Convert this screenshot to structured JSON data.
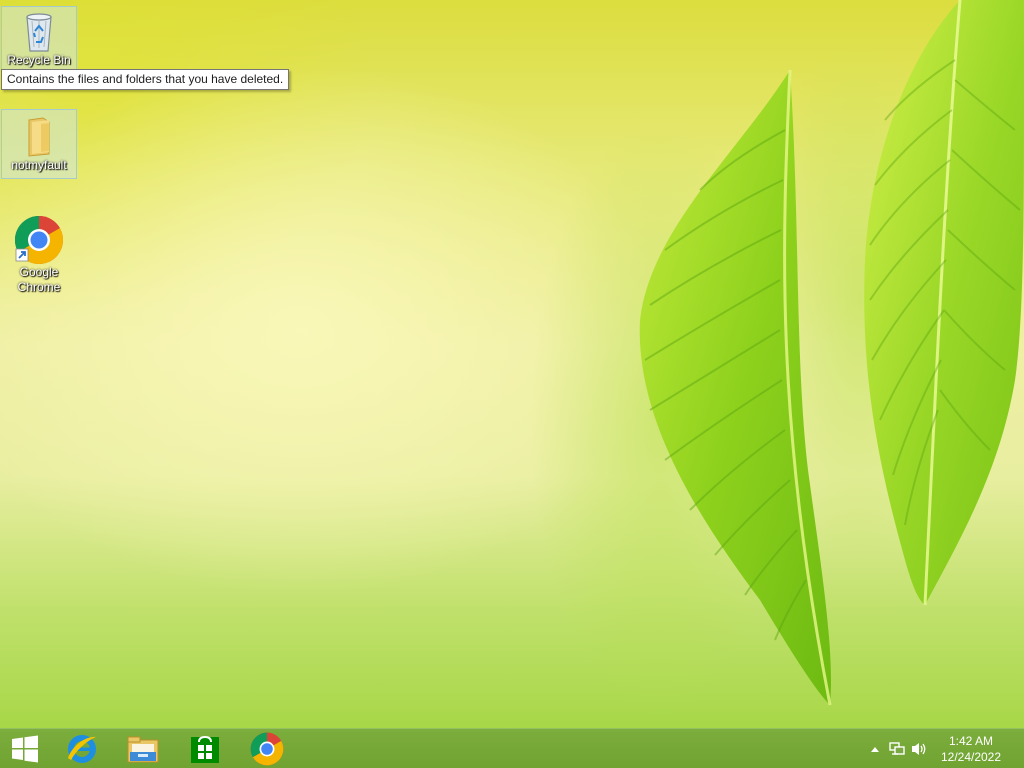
{
  "desktop": {
    "icons": [
      {
        "label": "Recycle Bin",
        "icon": "recycle-bin-icon"
      },
      {
        "label": "notmyfault",
        "icon": "folder-icon"
      },
      {
        "label": "Google Chrome",
        "icon": "chrome-icon"
      }
    ],
    "tooltip": "Contains the files and folders that you have deleted."
  },
  "taskbar": {
    "pinned": [
      {
        "name": "Internet Explorer",
        "icon": "internet-explorer-icon"
      },
      {
        "name": "File Explorer",
        "icon": "file-explorer-icon"
      },
      {
        "name": "Store",
        "icon": "store-icon"
      },
      {
        "name": "Google Chrome",
        "icon": "chrome-icon"
      }
    ],
    "tray": {
      "icons": [
        "show-hidden-icons-arrow",
        "network-icon",
        "volume-icon"
      ],
      "time": "1:42 AM",
      "date": "12/24/2022"
    }
  },
  "colors": {
    "taskbar": "#74a83e",
    "wallpaper_leaf": "#7cc71f",
    "chrome_red": "#db4437",
    "chrome_green": "#0f9d58",
    "chrome_yellow": "#f4b400",
    "chrome_blue": "#4285f4"
  }
}
